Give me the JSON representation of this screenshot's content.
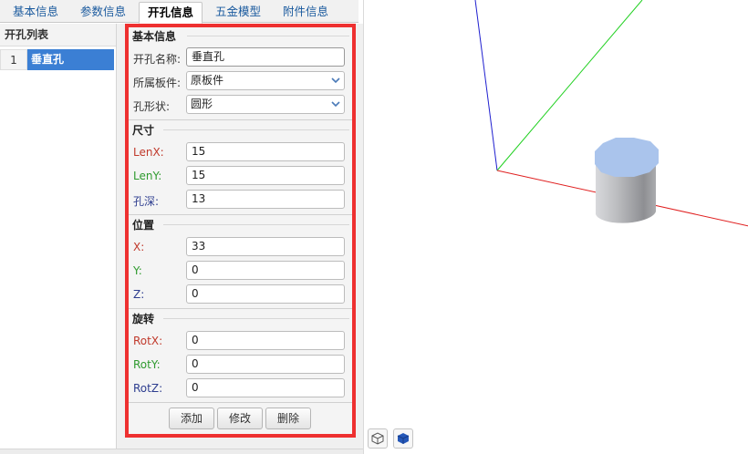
{
  "tabs": [
    {
      "label": "基本信息",
      "active": false
    },
    {
      "label": "参数信息",
      "active": false
    },
    {
      "label": "开孔信息",
      "active": true
    },
    {
      "label": "五金模型",
      "active": false
    },
    {
      "label": "附件信息",
      "active": false
    }
  ],
  "hole_list": {
    "header": "开孔列表",
    "rows": [
      {
        "num": "1",
        "name": "垂直孔"
      }
    ]
  },
  "form": {
    "basic": {
      "title": "基本信息",
      "name_label": "开孔名称:",
      "name_value": "垂直孔",
      "board_label": "所属板件:",
      "board_value": "原板件",
      "shape_label": "孔形状:",
      "shape_value": "圆形"
    },
    "size": {
      "title": "尺寸",
      "lenx_label": "LenX:",
      "lenx_value": "15",
      "leny_label": "LenY:",
      "leny_value": "15",
      "depth_label": "孔深:",
      "depth_value": "13"
    },
    "position": {
      "title": "位置",
      "x_label": "X:",
      "x_value": "33",
      "y_label": "Y:",
      "y_value": "0",
      "z_label": "Z:",
      "z_value": "0"
    },
    "rotation": {
      "title": "旋转",
      "rotx_label": "RotX:",
      "rotx_value": "0",
      "roty_label": "RotY:",
      "roty_value": "0",
      "rotz_label": "RotZ:",
      "rotz_value": "0"
    },
    "buttons": {
      "add": "添加",
      "edit": "修改",
      "delete": "删除"
    }
  },
  "colors": {
    "highlight_border": "#ee3030",
    "selected_row": "#3b7fd4",
    "axis_x": "#e02020",
    "axis_y": "#20d020",
    "axis_z": "#2020d0",
    "cylinder_top": "#aac4ec"
  },
  "icons": {
    "viewport_button_1": "box-outline-icon",
    "viewport_button_2": "box-solid-icon"
  }
}
